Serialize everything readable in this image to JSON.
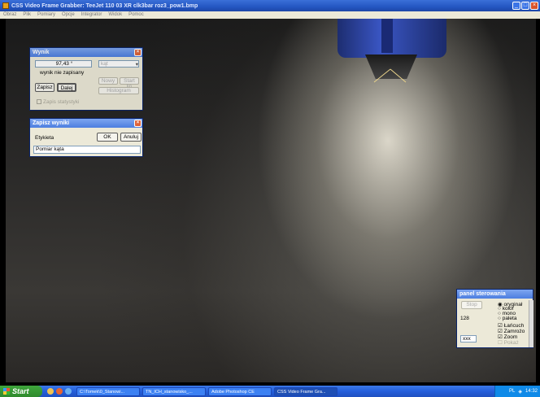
{
  "window": {
    "title": "CSS Video Frame Grabber: TeeJet 110 03 XR clk3bar roz3_pow1.bmp",
    "menu": [
      "Obraz",
      "Plik",
      "Pomiary",
      "Opcje",
      "Integrator",
      "Widok",
      "Pomoc"
    ]
  },
  "wynik": {
    "title": "Wynik",
    "value": "97,43 °",
    "unit_select": "kąt",
    "status": "wynik nie zapisany",
    "save_label": "Zapisz",
    "next_label": "Dalej",
    "btn_grey1": "Nowy",
    "btn_grey2": "Start lin",
    "btn_grey3": "Histogram",
    "checkbox_label": "Zapis statystyki"
  },
  "zapisz": {
    "title": "Zapisz wyniki",
    "label_caption": "Etykieta",
    "ok_label": "OK",
    "cancel_label": "Anuluj",
    "label_value": "Pomiar kąta"
  },
  "panel": {
    "title": "panel sterowania",
    "stop_label": "Stop",
    "value": "128",
    "zoom_select": "xxx",
    "radio_original": "oryginał",
    "radio_color": "kolor",
    "radio_mono": "mono",
    "radio_palette": "paleta",
    "chk_chain": "Łańcuch",
    "chk_freeze": "Zamrożo",
    "chk_zoom": "Zoom",
    "chk_extra": "Pokaż"
  },
  "taskbar": {
    "start_label": "Start",
    "tasks": [
      "C:\\Tomek\\0_Stanowi...",
      "TN_ICH_stanowisko_...",
      "Adobe Photoshop CE",
      "CSS Video Frame Gra..."
    ],
    "lang": "PL",
    "clock": "14:32"
  }
}
